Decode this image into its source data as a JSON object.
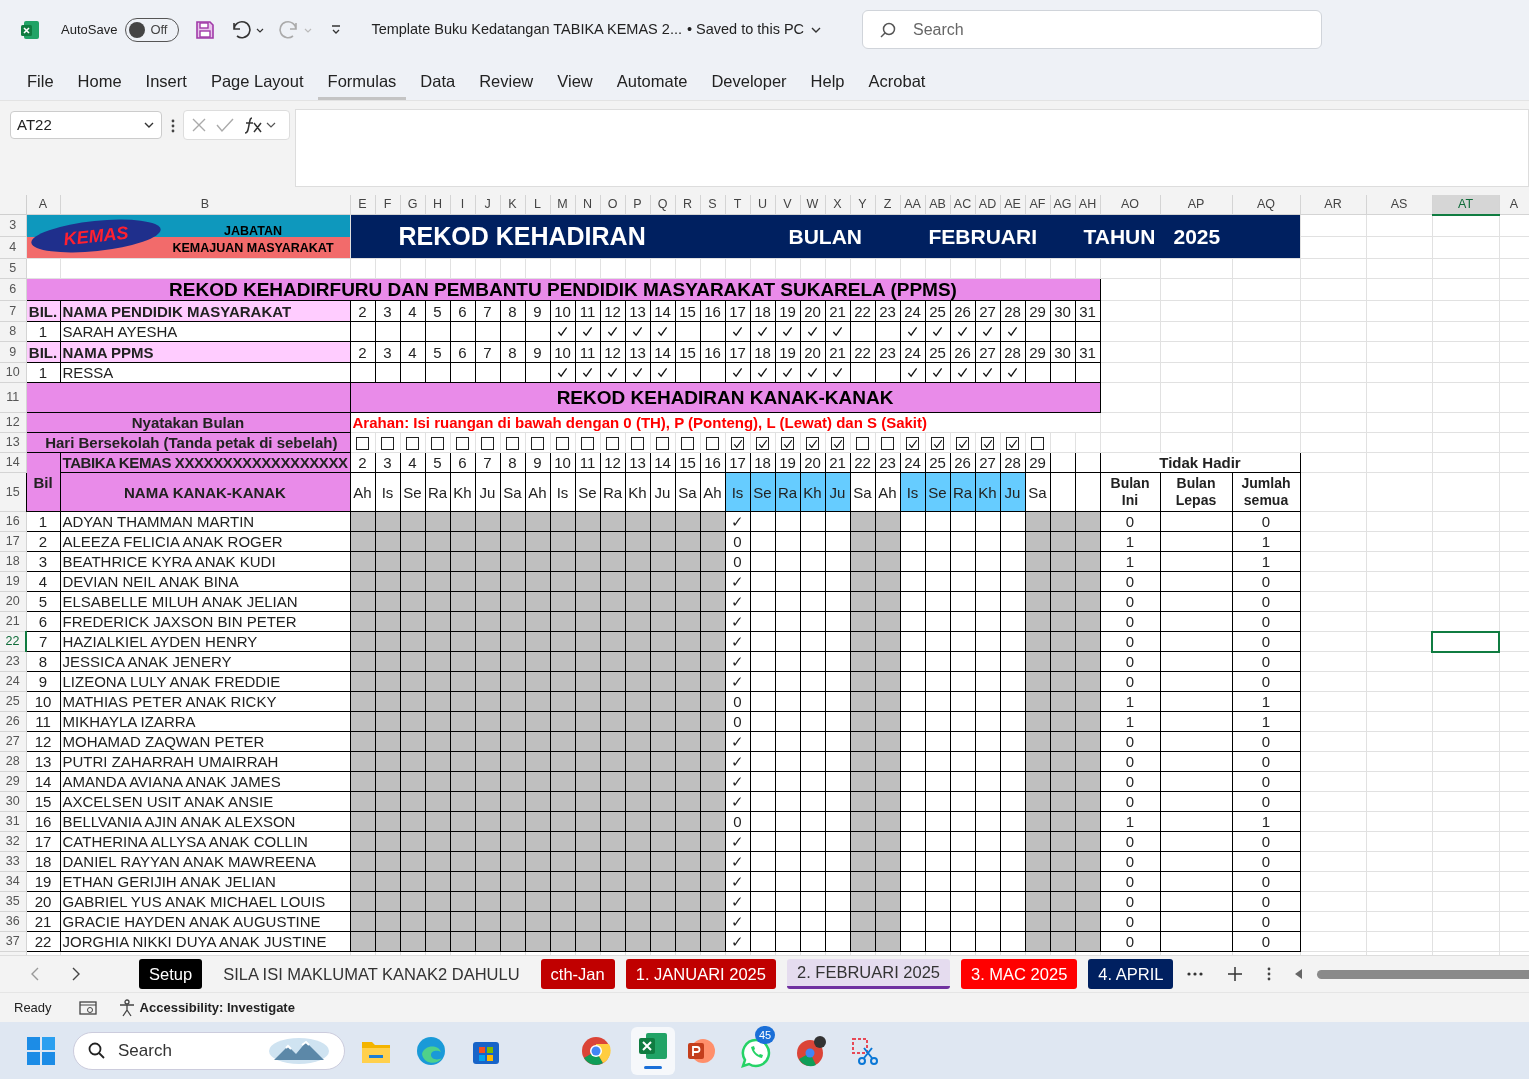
{
  "title_bar": {
    "autosave_label": "AutoSave",
    "autosave": {
      "on": false,
      "label": "Off"
    },
    "document_title": "Template Buku Kedatangan TABIKA KEMAS 2...",
    "save_status": "• Saved to this PC",
    "search_placeholder": "Search"
  },
  "ribbon_tabs": [
    {
      "label": "File",
      "selected": false
    },
    {
      "label": "Home",
      "selected": false
    },
    {
      "label": "Insert",
      "selected": false
    },
    {
      "label": "Page Layout",
      "selected": false
    },
    {
      "label": "Formulas",
      "selected": true
    },
    {
      "label": "Data",
      "selected": false
    },
    {
      "label": "Review",
      "selected": false
    },
    {
      "label": "View",
      "selected": false
    },
    {
      "label": "Automate",
      "selected": false
    },
    {
      "label": "Developer",
      "selected": false
    },
    {
      "label": "Help",
      "selected": false
    },
    {
      "label": "Acrobat",
      "selected": false
    }
  ],
  "formula_bar": {
    "name_box": "AT22"
  },
  "column_headers": [
    {
      "label": "A",
      "selected": false
    },
    {
      "label": "B",
      "selected": false
    },
    {
      "label": "E",
      "selected": false
    },
    {
      "label": "F",
      "selected": false
    },
    {
      "label": "G",
      "selected": false
    },
    {
      "label": "H",
      "selected": false
    },
    {
      "label": "I",
      "selected": false
    },
    {
      "label": "J",
      "selected": false
    },
    {
      "label": "K",
      "selected": false
    },
    {
      "label": "L",
      "selected": false
    },
    {
      "label": "M",
      "selected": false
    },
    {
      "label": "N",
      "selected": false
    },
    {
      "label": "O",
      "selected": false
    },
    {
      "label": "P",
      "selected": false
    },
    {
      "label": "Q",
      "selected": false
    },
    {
      "label": "R",
      "selected": false
    },
    {
      "label": "S",
      "selected": false
    },
    {
      "label": "T",
      "selected": false
    },
    {
      "label": "U",
      "selected": false
    },
    {
      "label": "V",
      "selected": false
    },
    {
      "label": "W",
      "selected": false
    },
    {
      "label": "X",
      "selected": false
    },
    {
      "label": "Y",
      "selected": false
    },
    {
      "label": "Z",
      "selected": false
    },
    {
      "label": "AA",
      "selected": false
    },
    {
      "label": "AB",
      "selected": false
    },
    {
      "label": "AC",
      "selected": false
    },
    {
      "label": "AD",
      "selected": false
    },
    {
      "label": "AE",
      "selected": false
    },
    {
      "label": "AF",
      "selected": false
    },
    {
      "label": "AG",
      "selected": false
    },
    {
      "label": "AH",
      "selected": false
    },
    {
      "label": "AO",
      "selected": false
    },
    {
      "label": "AP",
      "selected": false
    },
    {
      "label": "AQ",
      "selected": false
    },
    {
      "label": "AR",
      "selected": false
    },
    {
      "label": "AS",
      "selected": false
    },
    {
      "label": "AT",
      "selected": true
    },
    {
      "label": "A",
      "selected": false
    }
  ],
  "row_headers": [
    {
      "label": "3",
      "selected": false
    },
    {
      "label": "4",
      "selected": false
    },
    {
      "label": "5",
      "selected": false
    },
    {
      "label": "6",
      "selected": false
    },
    {
      "label": "7",
      "selected": false
    },
    {
      "label": "8",
      "selected": false
    },
    {
      "label": "9",
      "selected": false
    },
    {
      "label": "10",
      "selected": false
    },
    {
      "label": "11",
      "selected": false
    },
    {
      "label": "12",
      "selected": false
    },
    {
      "label": "13",
      "selected": false
    },
    {
      "label": "14",
      "selected": false
    },
    {
      "label": "15",
      "selected": false
    },
    {
      "label": "16",
      "selected": false
    },
    {
      "label": "17",
      "selected": false
    },
    {
      "label": "18",
      "selected": false
    },
    {
      "label": "19",
      "selected": false
    },
    {
      "label": "20",
      "selected": false
    },
    {
      "label": "21",
      "selected": false
    },
    {
      "label": "22",
      "selected": true
    },
    {
      "label": "23",
      "selected": false
    },
    {
      "label": "24",
      "selected": false
    },
    {
      "label": "25",
      "selected": false
    },
    {
      "label": "26",
      "selected": false
    },
    {
      "label": "27",
      "selected": false
    },
    {
      "label": "28",
      "selected": false
    },
    {
      "label": "29",
      "selected": false
    },
    {
      "label": "30",
      "selected": false
    },
    {
      "label": "31",
      "selected": false
    },
    {
      "label": "32",
      "selected": false
    },
    {
      "label": "33",
      "selected": false
    },
    {
      "label": "34",
      "selected": false
    },
    {
      "label": "35",
      "selected": false
    },
    {
      "label": "36",
      "selected": false
    },
    {
      "label": "37",
      "selected": false
    }
  ],
  "sheet": {
    "logo": "KEMAS",
    "department": [
      "JABATAN",
      "KEMAJUAN MASYARAKAT"
    ],
    "banner": {
      "title": "REKOD KEHADIRAN",
      "month_label": "BULAN",
      "month": "FEBRUARI",
      "year_label": "TAHUN",
      "year": "2025"
    },
    "staff_title": "REKOD KEHADIRFURU DAN PEMBANTU PENDIDIK MASYARAKAT SUKARELA (PPMS)",
    "staff_groups": [
      {
        "bil_header": "BIL.",
        "name_header": "NAMA PENDIDIK MASYARAKAT",
        "days": [
          "2",
          "3",
          "4",
          "5",
          "6",
          "7",
          "8",
          "9",
          "10",
          "11",
          "12",
          "13",
          "14",
          "15",
          "16",
          "17",
          "18",
          "19",
          "20",
          "21",
          "22",
          "23",
          "24",
          "25",
          "26",
          "27",
          "28",
          "29",
          "30",
          "31"
        ],
        "rows": [
          {
            "bil": "1",
            "name": "SARAH AYESHA",
            "present": [
              false,
              false,
              false,
              false,
              false,
              false,
              false,
              false,
              true,
              true,
              true,
              true,
              true,
              false,
              false,
              true,
              true,
              true,
              true,
              true,
              false,
              false,
              true,
              true,
              true,
              true,
              true,
              false,
              false,
              false
            ]
          }
        ]
      },
      {
        "bil_header": "BIL.",
        "name_header": "NAMA PPMS",
        "days": [
          "2",
          "3",
          "4",
          "5",
          "6",
          "7",
          "8",
          "9",
          "10",
          "11",
          "12",
          "13",
          "14",
          "15",
          "16",
          "17",
          "18",
          "19",
          "20",
          "21",
          "22",
          "23",
          "24",
          "25",
          "26",
          "27",
          "28",
          "29",
          "30",
          "31"
        ],
        "rows": [
          {
            "bil": "1",
            "name": "RESSA",
            "present": [
              false,
              false,
              false,
              false,
              false,
              false,
              false,
              false,
              true,
              true,
              true,
              true,
              true,
              false,
              false,
              true,
              true,
              true,
              true,
              true,
              false,
              false,
              true,
              true,
              true,
              true,
              true,
              false,
              false,
              false
            ]
          }
        ]
      }
    ],
    "children_title": "REKOD KEHADIRAN KANAK-KANAK",
    "month_prompt": "Nyatakan Bulan",
    "instruction": "Arahan: Isi ruangan di bawah dengan 0 (TH), P (Ponteng), L (Lewat) dan S (Sakit)",
    "school_days_label": "Hari Bersekolah (Tanda petak di sebelah)",
    "bil_header": "Bil",
    "tabika": "TABIKA KEMAS XXXXXXXXXXXXXXXXXX",
    "name_header": "NAMA KANAK-KANAK",
    "school_days": [
      {
        "day": "2",
        "weekday": "Ah",
        "checked": false
      },
      {
        "day": "3",
        "weekday": "Is",
        "checked": false
      },
      {
        "day": "4",
        "weekday": "Se",
        "checked": false
      },
      {
        "day": "5",
        "weekday": "Ra",
        "checked": false
      },
      {
        "day": "6",
        "weekday": "Kh",
        "checked": false
      },
      {
        "day": "7",
        "weekday": "Ju",
        "checked": false
      },
      {
        "day": "8",
        "weekday": "Sa",
        "checked": false
      },
      {
        "day": "9",
        "weekday": "Ah",
        "checked": false
      },
      {
        "day": "10",
        "weekday": "Is",
        "checked": false
      },
      {
        "day": "11",
        "weekday": "Se",
        "checked": false
      },
      {
        "day": "12",
        "weekday": "Ra",
        "checked": false
      },
      {
        "day": "13",
        "weekday": "Kh",
        "checked": false
      },
      {
        "day": "14",
        "weekday": "Ju",
        "checked": false
      },
      {
        "day": "15",
        "weekday": "Sa",
        "checked": false
      },
      {
        "day": "16",
        "weekday": "Ah",
        "checked": false
      },
      {
        "day": "17",
        "weekday": "Is",
        "checked": true
      },
      {
        "day": "18",
        "weekday": "Se",
        "checked": true
      },
      {
        "day": "19",
        "weekday": "Ra",
        "checked": true
      },
      {
        "day": "20",
        "weekday": "Kh",
        "checked": true
      },
      {
        "day": "21",
        "weekday": "Ju",
        "checked": true
      },
      {
        "day": "22",
        "weekday": "Sa",
        "checked": false
      },
      {
        "day": "23",
        "weekday": "Ah",
        "checked": false
      },
      {
        "day": "24",
        "weekday": "Is",
        "checked": true
      },
      {
        "day": "25",
        "weekday": "Se",
        "checked": true
      },
      {
        "day": "26",
        "weekday": "Ra",
        "checked": true
      },
      {
        "day": "27",
        "weekday": "Kh",
        "checked": true
      },
      {
        "day": "28",
        "weekday": "Ju",
        "checked": true
      },
      {
        "day": "29",
        "weekday": "Sa",
        "checked": false
      }
    ],
    "absence_header": "Tidak Hadir",
    "absence_columns": [
      "Bulan Ini",
      "Bulan Lepas",
      "Jumlah semua"
    ],
    "children": [
      {
        "bil": "1",
        "name": "ADYAN THAMMAN MARTIN",
        "entry": "✓",
        "this_month": "0",
        "total": "0"
      },
      {
        "bil": "2",
        "name": "ALEEZA FELICIA ANAK ROGER",
        "entry": "0",
        "this_month": "1",
        "total": "1"
      },
      {
        "bil": "3",
        "name": "BEATHRICE KYRA ANAK KUDI",
        "entry": "0",
        "this_month": "1",
        "total": "1"
      },
      {
        "bil": "4",
        "name": "DEVIAN NEIL ANAK BINA",
        "entry": "✓",
        "this_month": "0",
        "total": "0"
      },
      {
        "bil": "5",
        "name": "ELSABELLE MILUH ANAK JELIAN",
        "entry": "✓",
        "this_month": "0",
        "total": "0"
      },
      {
        "bil": "6",
        "name": "FREDERICK JAXSON BIN PETER",
        "entry": "✓",
        "this_month": "0",
        "total": "0"
      },
      {
        "bil": "7",
        "name": "HAZIALKIEL AYDEN HENRY",
        "entry": "✓",
        "this_month": "0",
        "total": "0"
      },
      {
        "bil": "8",
        "name": "JESSICA ANAK JENERY",
        "entry": "✓",
        "this_month": "0",
        "total": "0"
      },
      {
        "bil": "9",
        "name": "LIZEONA LULY ANAK FREDDIE",
        "entry": "✓",
        "this_month": "0",
        "total": "0"
      },
      {
        "bil": "10",
        "name": "MATHIAS PETER ANAK RICKY",
        "entry": "0",
        "this_month": "1",
        "total": "1"
      },
      {
        "bil": "11",
        "name": "MIKHAYLA IZARRA",
        "entry": "0",
        "this_month": "1",
        "total": "1"
      },
      {
        "bil": "12",
        "name": "MOHAMAD ZAQWAN PETER",
        "entry": "✓",
        "this_month": "0",
        "total": "0"
      },
      {
        "bil": "13",
        "name": "PUTRI ZAHARRAH UMAIRRAH",
        "entry": "✓",
        "this_month": "0",
        "total": "0"
      },
      {
        "bil": "14",
        "name": "AMANDA AVIANA ANAK JAMES",
        "entry": "✓",
        "this_month": "0",
        "total": "0"
      },
      {
        "bil": "15",
        "name": "AXCELSEN USIT ANAK ANSIE",
        "entry": "✓",
        "this_month": "0",
        "total": "0"
      },
      {
        "bil": "16",
        "name": "BELLVANIA AJIN ANAK ALEXSON",
        "entry": "0",
        "this_month": "1",
        "total": "1"
      },
      {
        "bil": "17",
        "name": "CATHERINA ALLYSA ANAK COLLIN",
        "entry": "✓",
        "this_month": "0",
        "total": "0"
      },
      {
        "bil": "18",
        "name": "DANIEL RAYYAN ANAK MAWREENA",
        "entry": "✓",
        "this_month": "0",
        "total": "0"
      },
      {
        "bil": "19",
        "name": "ETHAN GERIJIH ANAK JELIAN",
        "entry": "✓",
        "this_month": "0",
        "total": "0"
      },
      {
        "bil": "20",
        "name": "GABRIEL YUS ANAK MICHAEL LOUIS",
        "entry": "✓",
        "this_month": "0",
        "total": "0"
      },
      {
        "bil": "21",
        "name": "GRACIE HAYDEN ANAK AUGUSTINE",
        "entry": "✓",
        "this_month": "0",
        "total": "0"
      },
      {
        "bil": "22",
        "name": "JORGHIA NIKKI DUYA ANAK JUSTINE",
        "entry": "✓",
        "this_month": "0",
        "total": "0"
      }
    ]
  },
  "sheet_tabs": [
    {
      "label": "Setup",
      "color": "#000000",
      "selected": false
    },
    {
      "label": "SILA ISI MAKLUMAT KANAK2 DAHULU",
      "selected": false
    },
    {
      "label": "cth-Jan",
      "color": "#c00000",
      "selected": false
    },
    {
      "label": "1. JANUARI 2025",
      "color": "#c00000",
      "selected": false
    },
    {
      "label": "2. FEBRUARI 2025",
      "color": "#7030a0",
      "selected": true
    },
    {
      "label": "3. MAC 2025",
      "color": "#ff0000",
      "selected": false
    },
    {
      "label": "4. APRIL",
      "color": "#002060",
      "selected": false
    }
  ],
  "status_bar": {
    "mode": "Ready",
    "accessibility": "Accessibility: Investigate"
  },
  "taskbar": {
    "search_placeholder": "Search",
    "whatsapp_badge": "45"
  }
}
